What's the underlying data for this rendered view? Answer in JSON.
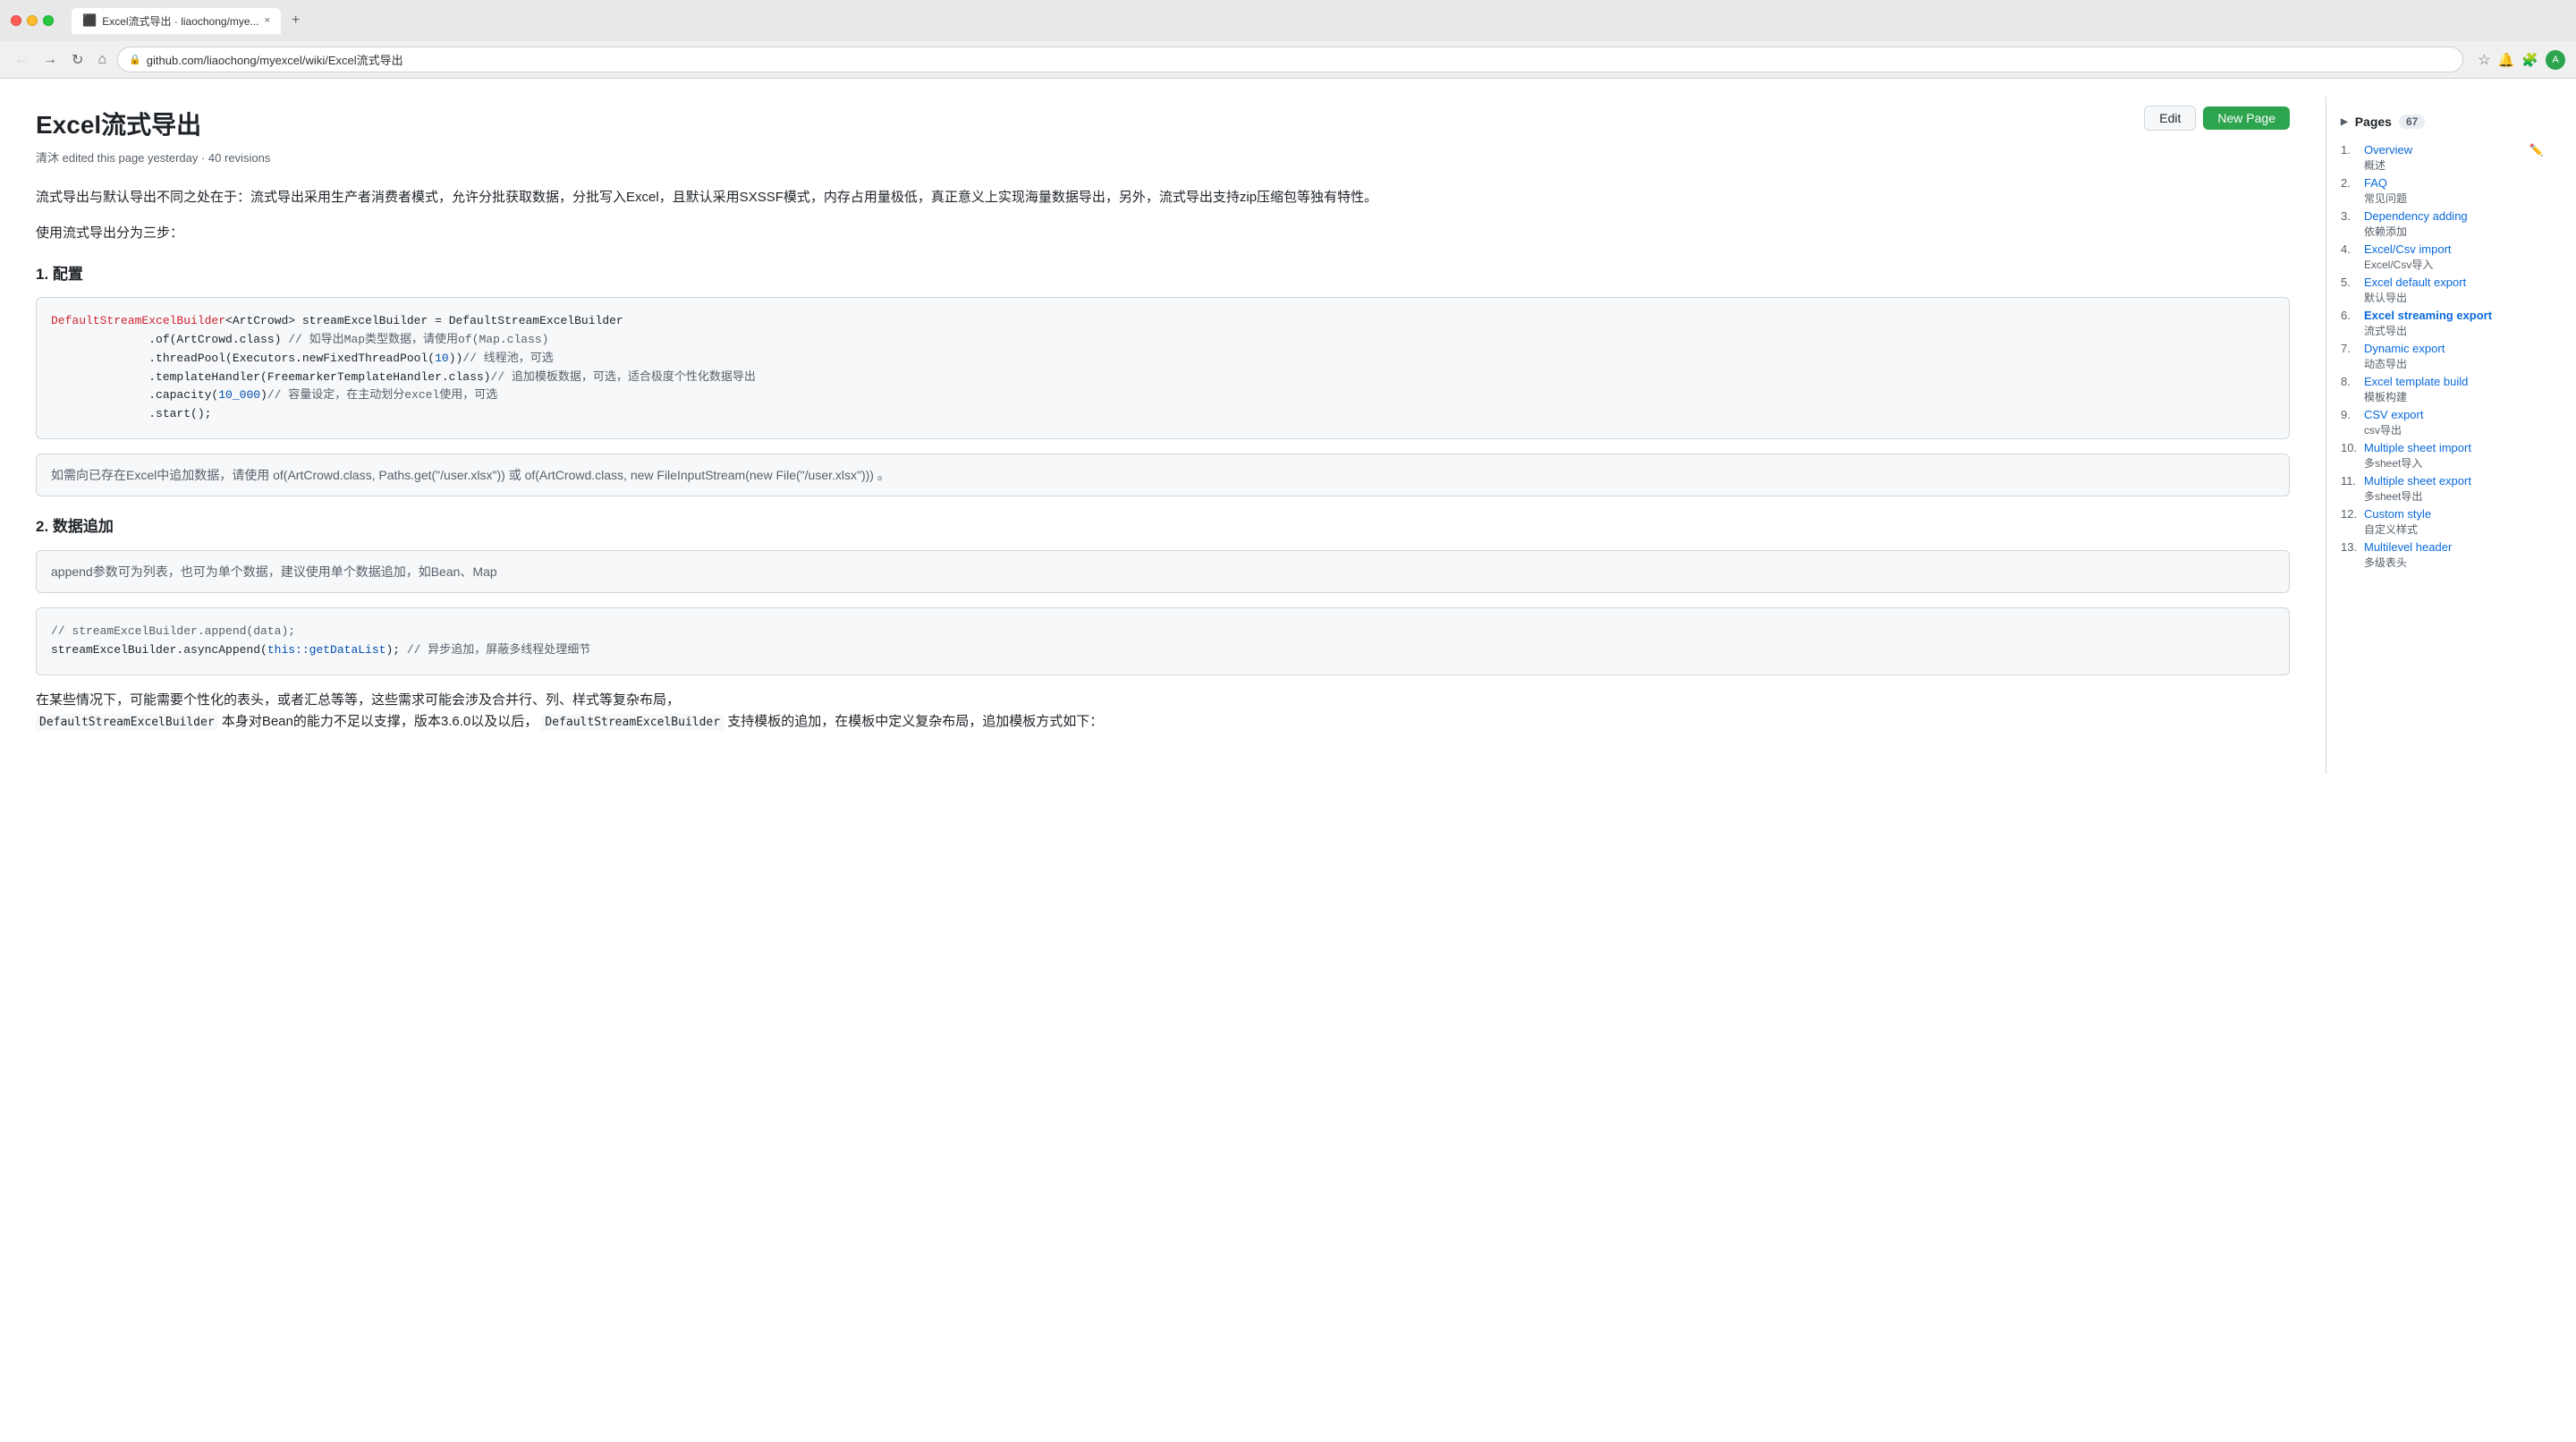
{
  "browser": {
    "traffic_lights": [
      "red",
      "yellow",
      "green"
    ],
    "tab_title": "Excel流式导出 · liaochong/mye...",
    "tab_close": "×",
    "tab_new": "+",
    "nav_back": "←",
    "nav_forward": "→",
    "nav_refresh": "↻",
    "nav_home": "⌂",
    "url": "github.com/liaochong/myexcel/wiki/Excel流式导出",
    "star_icon": "☆",
    "extensions": "🧩"
  },
  "header": {
    "title": "Excel流式导出",
    "edit_label": "Edit",
    "new_page_label": "New Page",
    "meta_text": "清沐 edited this page yesterday · 40 revisions"
  },
  "content": {
    "intro1": "流式导出与默认导出不同之处在于：流式导出采用生产者消费者模式，允许分批获取数据，分批写入Excel，且默认采用SXSSF模式，内存占用量极低，真正意义上实现海量数据导出，另外，流式导出支持zip压缩包等独有特性。",
    "intro2": "使用流式导出分为三步：",
    "step1": "1. 配置",
    "code1_lines": [
      {
        "text": "DefaultStreamExcelBuilder",
        "cls": "code-red"
      },
      {
        "text": "<ArtCrowd> streamExcelBuilder = DefaultStreamExcelBuilder",
        "cls": "code-default"
      },
      {
        "text": "              .of(ArtCrowd.class) // 如导出Map类型数据，请使用of(Map.class)",
        "cls": "code-gray"
      },
      {
        "text": "              .threadPool(Executors.newFixedThreadPool(",
        "cls": "code-default"
      },
      {
        "text": "10",
        "cls": "code-blue"
      },
      {
        "text": "))// 线程池，可选",
        "cls": "code-gray"
      },
      {
        "text": "              .templateHandler(FreemarkerTemplateHandler.class)// 追加模板数据，可选，适合极度个性化数据导出",
        "cls": "code-gray"
      },
      {
        "text": "              .capacity(",
        "cls": "code-default"
      },
      {
        "text": "10_000",
        "cls": "code-blue"
      },
      {
        "text": ")// 容量设定，在主动划分excel使用，可选",
        "cls": "code-gray"
      },
      {
        "text": "              .start();",
        "cls": "code-default"
      }
    ],
    "note1": "如需向已存在Excel中追加数据，请使用 of(ArtCrowd.class, Paths.get(\"/user.xlsx\")) 或 of(ArtCrowd.class, new FileInputStream(new File(\"/user.xlsx\"))) 。",
    "step2": "2. 数据追加",
    "note2": "append参数可为列表，也可为单个数据，建议使用单个数据追加，如Bean、Map",
    "code2": "// streamExcelBuilder.append(data);\nstreamExcelBuilder.asyncAppend(this::getDataList); // 异步追加，屏蔽多线程处理细节",
    "intro3_parts": [
      "在某些情况下，可能需要个性化的表头，或者汇总等等，这些需求可能会涉及合并行、列、样式等复杂布局，",
      " DefaultStreamExcelBuilder 本身对Bean的能力不足以支撑，版本3.6.0以及以后，",
      " DefaultStreamExcelBuilder 支持模板的追加，在模板中定义复杂布局，追加模板方式如下："
    ]
  },
  "sidebar": {
    "pages_label": "Pages",
    "pages_count": "67",
    "items": [
      {
        "num": "1.",
        "en": "Overview",
        "cn": "概述",
        "active": true
      },
      {
        "num": "2.",
        "en": "FAQ",
        "cn": "常见问题"
      },
      {
        "num": "3.",
        "en": "Dependency adding",
        "cn": "依赖添加"
      },
      {
        "num": "4.",
        "en": "Excel/Csv import",
        "cn": "Excel/Csv导入"
      },
      {
        "num": "5.",
        "en": "Excel default export",
        "cn": "默认导出"
      },
      {
        "num": "6.",
        "en": "Excel streaming export",
        "cn": "流式导出",
        "current": true
      },
      {
        "num": "7.",
        "en": "Dynamic export",
        "cn": "动态导出"
      },
      {
        "num": "8.",
        "en": "Excel template build",
        "cn": "模板构建"
      },
      {
        "num": "9.",
        "en": "CSV export",
        "cn": "csv导出"
      },
      {
        "num": "10.",
        "en": "Multiple sheet import",
        "cn": "多sheet导入"
      },
      {
        "num": "11.",
        "en": "Multiple sheet export",
        "cn": "多sheet导出"
      },
      {
        "num": "12.",
        "en": "Custom style",
        "cn": "自定义样式"
      },
      {
        "num": "13.",
        "en": "Multilevel header",
        "cn": "多级表头"
      }
    ]
  }
}
